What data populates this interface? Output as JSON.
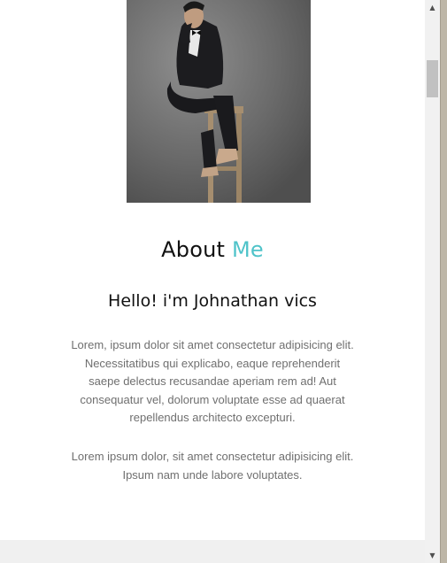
{
  "about": {
    "title_word": "About",
    "title_accent": "Me",
    "greeting": "Hello! i'm Johnathan vics",
    "paragraph1": "Lorem, ipsum dolor sit amet consectetur adipisicing elit. Necessitatibus qui explicabo, eaque reprehenderit saepe delectus recusandae aperiam rem ad! Aut consequatur vel, dolorum voluptate esse ad quaerat repellendus architecto excepturi.",
    "paragraph2": "Lorem ipsum dolor, sit amet consectetur adipisicing elit. Ipsum nam unde labore voluptates."
  },
  "colors": {
    "accent": "#4fc3c9",
    "heading": "#111111",
    "body_text": "#6f6f6f"
  },
  "scrollbar": {
    "up_icon": "chevron-up-icon",
    "down_icon": "chevron-down-icon"
  }
}
